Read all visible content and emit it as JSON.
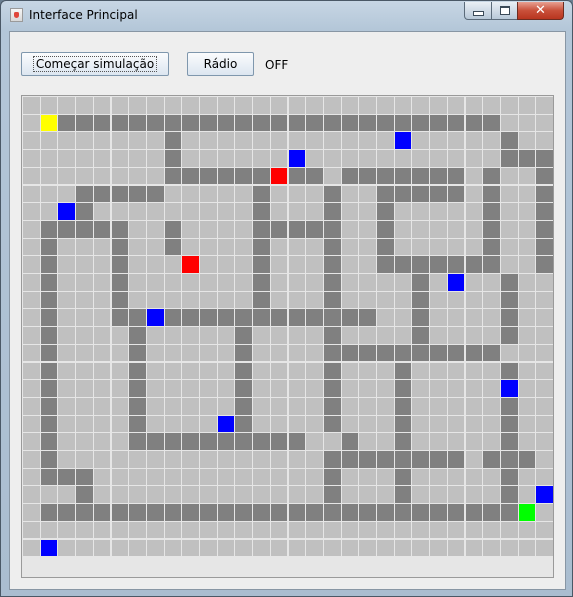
{
  "window": {
    "title": "Interface Principal",
    "controls": {
      "minimize": "minimize",
      "maximize": "maximize",
      "close": "✕"
    }
  },
  "toolbar": {
    "simulate_label": "Começar simulação",
    "radio_label": "Rádio",
    "radio_status": "OFF"
  },
  "colors": {
    "empty": "#c0c0c0",
    "wall": "#808080",
    "gridline": "#e6e6e6",
    "start": "#ffff00",
    "goal": "#00ff00",
    "blue_agent": "#0000ff",
    "red_agent": "#ff0000"
  },
  "grid": {
    "cols": 30,
    "rows": 26,
    "map": [
      "..............................",
      "..#########################...",
      "........#..................#..",
      "........#..................###",
      "........#########.#######.#..#",
      "...#####.....#...#..#####.#..#",
      "...#.........#...#..#.....#..#",
      ".#####..#....#####..#.....#..#",
      ".#...#..#....#...#..#.....#..#",
      ".#...#.......#...#..#######..#",
      ".#...#.......#...#....#....#..",
      ".#...#.......#...#....#....#..",
      ".#...###############..#....#..",
      ".#....#.....#....#....#....#..",
      ".#....#.....#....##########...",
      ".#....#.....#....#...#.....#..",
      ".#....#.....#....#...#.....#..",
      ".#....#.....#....#...#.....#..",
      ".#....#.....#....#...#.....#..",
      ".#....##########..#..#.....#..",
      ".#...............########.###.",
      ".###.............#...#.....#..",
      "...#.............#...#.....#..",
      ".###########################..",
      "..............................",
      ".............................."
    ],
    "markers": [
      {
        "type": "start",
        "row": 1,
        "col": 1
      },
      {
        "type": "goal",
        "row": 23,
        "col": 28
      },
      {
        "type": "red_agent",
        "row": 4,
        "col": 14
      },
      {
        "type": "red_agent",
        "row": 9,
        "col": 9
      },
      {
        "type": "blue_agent",
        "row": 2,
        "col": 21
      },
      {
        "type": "blue_agent",
        "row": 3,
        "col": 15
      },
      {
        "type": "blue_agent",
        "row": 6,
        "col": 2
      },
      {
        "type": "blue_agent",
        "row": 10,
        "col": 24
      },
      {
        "type": "blue_agent",
        "row": 12,
        "col": 7
      },
      {
        "type": "blue_agent",
        "row": 16,
        "col": 27
      },
      {
        "type": "blue_agent",
        "row": 18,
        "col": 11
      },
      {
        "type": "blue_agent",
        "row": 22,
        "col": 29
      },
      {
        "type": "blue_agent",
        "row": 25,
        "col": 1
      }
    ]
  }
}
